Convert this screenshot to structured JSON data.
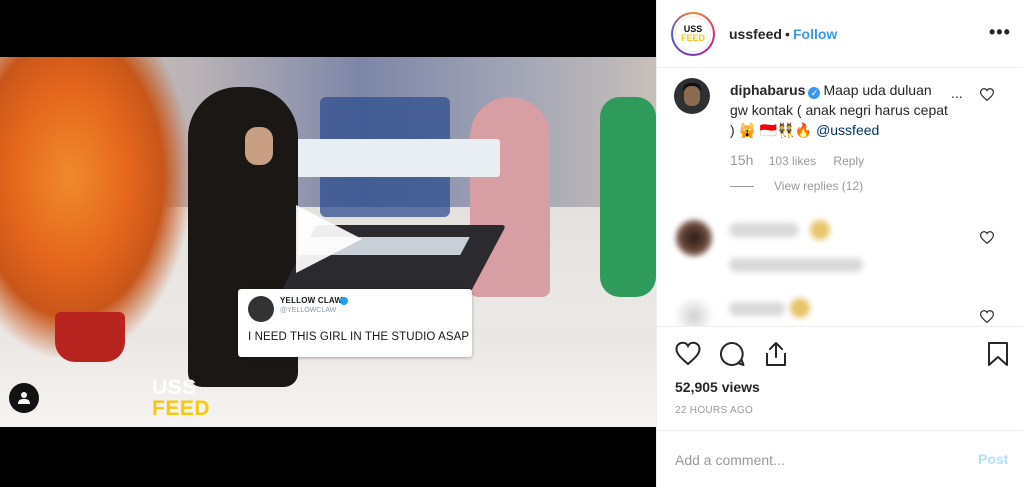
{
  "video": {
    "watermark_line1": "USS",
    "watermark_line2": "FEED",
    "tweet": {
      "name": "YELLOW CLAW",
      "handle": "@YELLOWCLAW",
      "text": "I NEED THIS GIRL IN THE STUDIO ASAP"
    }
  },
  "header": {
    "avatar_line1": "USS",
    "avatar_line2": "FEED",
    "username": "ussfeed",
    "separator": "•",
    "follow_label": "Follow",
    "more_label": "•••"
  },
  "comment": {
    "username": "diphabarus",
    "text": "Maap uda duluan gw kontak ( anak negri harus cepat ) 🙀 🇮🇩👯🔥",
    "mention": "@ussfeed",
    "ellipsis": "...",
    "time": "15h",
    "likes": "103 likes",
    "reply_label": "Reply",
    "view_replies": "View replies (12)"
  },
  "post": {
    "views": "52,905 views",
    "time_ago": "22 HOURS AGO"
  },
  "composer": {
    "placeholder": "Add a comment...",
    "post_label": "Post"
  },
  "colors": {
    "accent": "#3897f0",
    "post_disabled": "#b2dffc",
    "watermark_yellow": "#f6c90e"
  }
}
